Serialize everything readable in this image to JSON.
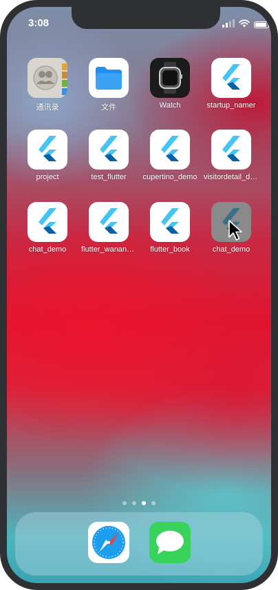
{
  "status_bar": {
    "time": "3:08",
    "battery_level": 0.9
  },
  "home": {
    "rows": [
      [
        {
          "label": "通讯录",
          "icon": "contacts-icon"
        },
        {
          "label": "文件",
          "icon": "files-folder-icon"
        },
        {
          "label": "Watch",
          "icon": "watch-icon"
        },
        {
          "label": "startup_namer",
          "icon": "flutter-logo-icon"
        }
      ],
      [
        {
          "label": "project",
          "icon": "flutter-logo-icon"
        },
        {
          "label": "test_flutter",
          "icon": "flutter-logo-icon"
        },
        {
          "label": "cupertino_demo",
          "icon": "flutter-logo-icon"
        },
        {
          "label": "visitordetail_demo",
          "icon": "flutter-logo-icon"
        }
      ],
      [
        {
          "label": "chat_demo",
          "icon": "flutter-logo-icon"
        },
        {
          "label": "flutter_wanandr...",
          "icon": "flutter-logo-icon"
        },
        {
          "label": "flutter_book",
          "icon": "flutter-logo-icon"
        },
        {
          "label": "chat_demo",
          "icon": "flutter-logo-icon",
          "state": "pressed"
        }
      ]
    ]
  },
  "page_indicator": {
    "pages": 4,
    "current": 3
  },
  "dock": {
    "apps": [
      {
        "name": "Safari",
        "icon": "safari-compass-icon"
      },
      {
        "name": "Messages",
        "icon": "messages-bubble-icon"
      }
    ]
  },
  "colors": {
    "flutter_light": "#44c5f4",
    "flutter_dark": "#0b5fa3",
    "files_blue": "#1f8ff0",
    "messages_green": "#39d25a",
    "safari_blue": "#1b9df0"
  }
}
